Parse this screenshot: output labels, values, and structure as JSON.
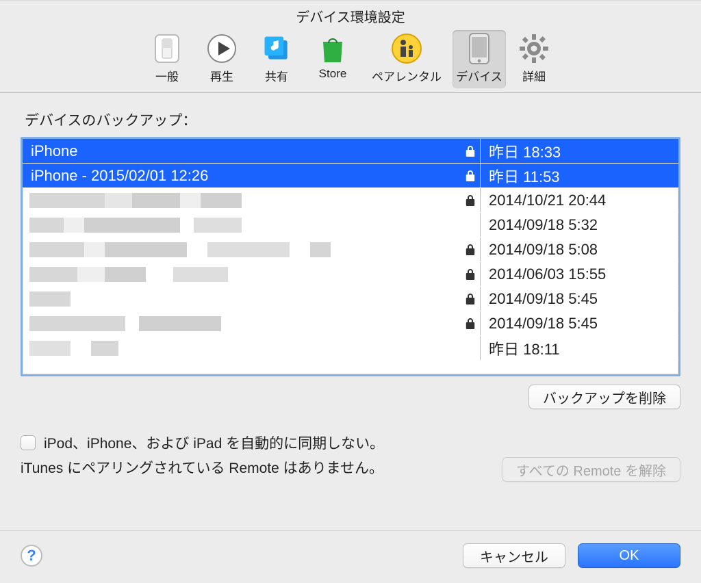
{
  "title": "デバイス環境設定",
  "tabs": [
    {
      "label": "一般",
      "name": "tab-general"
    },
    {
      "label": "再生",
      "name": "tab-playback"
    },
    {
      "label": "共有",
      "name": "tab-sharing"
    },
    {
      "label": "Store",
      "name": "tab-store"
    },
    {
      "label": "ペアレンタル",
      "name": "tab-parental"
    },
    {
      "label": "デバイス",
      "name": "tab-devices",
      "selected": true
    },
    {
      "label": "詳細",
      "name": "tab-advanced"
    }
  ],
  "sectionLabel": "デバイスのバックアップ：",
  "backups": [
    {
      "name": "iPhone",
      "lock": true,
      "date": "昨日 18:33",
      "selected": true,
      "redacted": false
    },
    {
      "name": "iPhone - 2015/02/01 12:26",
      "lock": true,
      "date": "昨日 11:53",
      "selected": true,
      "redacted": false
    },
    {
      "name": "",
      "lock": true,
      "date": "2014/10/21 20:44",
      "selected": false,
      "redacted": true
    },
    {
      "name": "",
      "lock": false,
      "date": "2014/09/18 5:32",
      "selected": false,
      "redacted": true
    },
    {
      "name": "",
      "lock": true,
      "date": "2014/09/18 5:08",
      "selected": false,
      "redacted": true
    },
    {
      "name": "",
      "lock": true,
      "date": "2014/06/03 15:55",
      "selected": false,
      "redacted": true
    },
    {
      "name": "",
      "lock": true,
      "date": "2014/09/18 5:45",
      "selected": false,
      "redacted": true
    },
    {
      "name": "",
      "lock": true,
      "date": "2014/09/18 5:45",
      "selected": false,
      "redacted": true
    },
    {
      "name": "",
      "lock": false,
      "date": "昨日 18:11",
      "selected": false,
      "redacted": true
    }
  ],
  "deleteBackup": "バックアップを削除",
  "preventSync": "iPod、iPhone、および iPad を自動的に同期しない。",
  "remoteNote": "iTunes にペアリングされている Remote はありません。",
  "forgetRemotes": "すべての Remote を解除",
  "cancel": "キャンセル",
  "ok": "OK"
}
